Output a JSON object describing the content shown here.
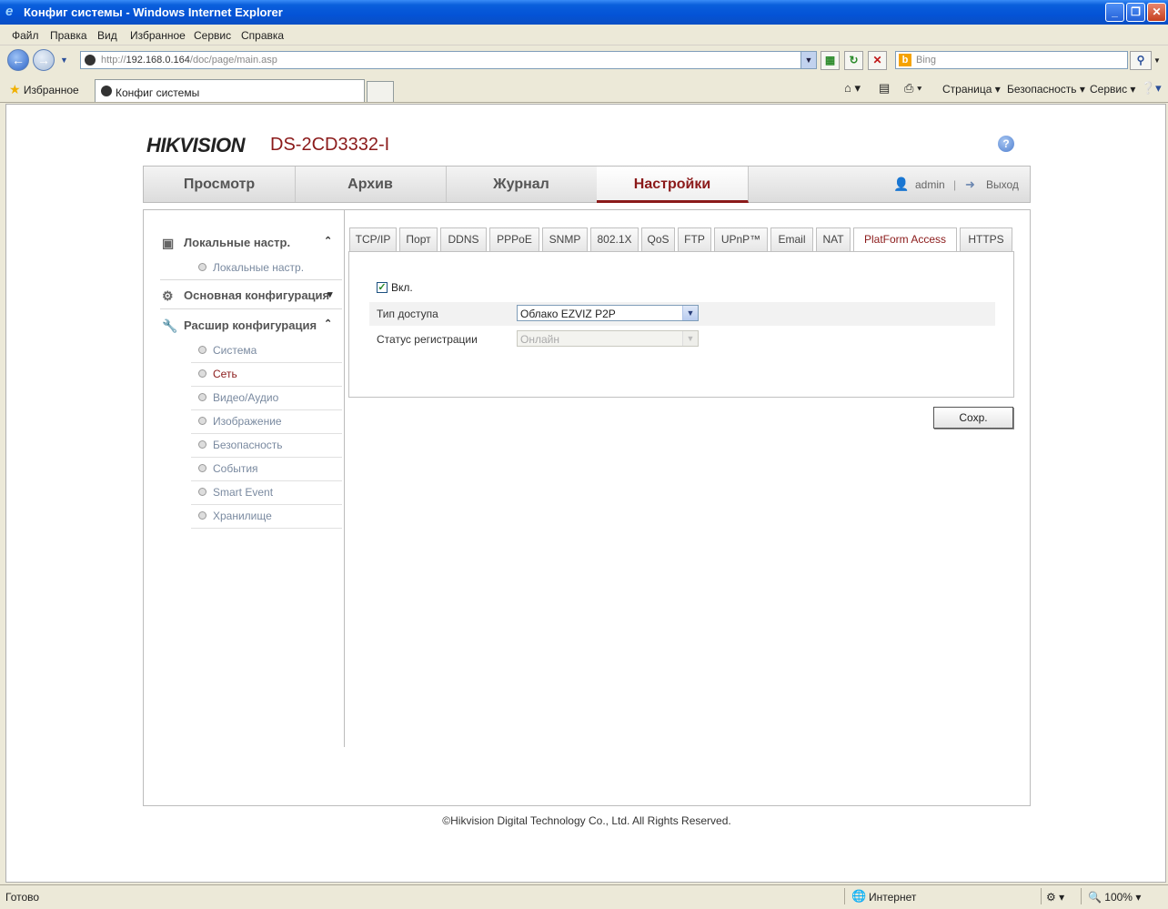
{
  "window": {
    "title": "Конфиг системы - Windows Internet Explorer",
    "minimize": "_",
    "maximize": "❐",
    "close": "✕"
  },
  "menu": [
    "Файл",
    "Правка",
    "Вид",
    "Избранное",
    "Сервис",
    "Справка"
  ],
  "address": {
    "url_prefix": "http://",
    "url_host": "192.168.0.164",
    "url_path": "/doc/page/main.asp",
    "search_placeholder": "Bing"
  },
  "favbar": {
    "favorites": "Избранное",
    "tab_title": "Конфиг системы",
    "page": "Страница",
    "security": "Безопасность",
    "service": "Сервис"
  },
  "header": {
    "brand": "HIKVISION",
    "model": "DS-2CD3332-I",
    "help": "?"
  },
  "nav": {
    "items": [
      "Просмотр",
      "Архив",
      "Журнал",
      "Настройки"
    ],
    "user": "admin",
    "separator": "|",
    "logout": "Выход"
  },
  "sidebar": {
    "local": "Локальные настр.",
    "local_items": [
      "Локальные настр."
    ],
    "basic": "Основная конфигурация",
    "advanced": "Расшир конфигурация",
    "advanced_items": [
      "Система",
      "Сеть",
      "Видео/Аудио",
      "Изображение",
      "Безопасность",
      "События",
      "Smart Event",
      "Хранилище"
    ]
  },
  "tabs": [
    "TCP/IP",
    "Порт",
    "DDNS",
    "PPPoE",
    "SNMP",
    "802.1X",
    "QoS",
    "FTP",
    "UPnP™",
    "Email",
    "NAT",
    "PlatForm Access",
    "HTTPS"
  ],
  "form": {
    "enable_label": "Вкл.",
    "access_type_label": "Тип доступа",
    "access_type_value": "Облако EZVIZ P2P",
    "reg_status_label": "Статус регистрации",
    "reg_status_value": "Онлайн",
    "save": "Сохр."
  },
  "footer": {
    "copyright": "©Hikvision Digital Technology Co., Ltd. All Rights Reserved."
  },
  "status": {
    "ready": "Готово",
    "zone": "Интернет",
    "zoom": "100%"
  },
  "colors": {
    "brand_red": "#c8141e",
    "active_red": "#8b1a1a",
    "xp_blue": "#0453d6"
  }
}
